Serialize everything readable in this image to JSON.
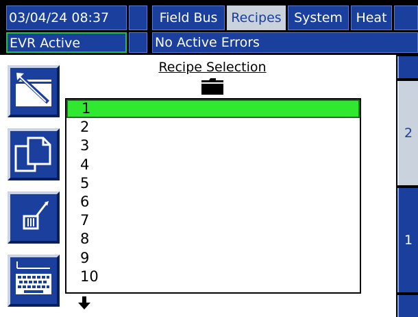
{
  "header": {
    "datetime": "03/04/24 08:37",
    "status": "EVR Active",
    "errors": "No Active Errors",
    "tabs": [
      {
        "label": "Field Bus",
        "active": false
      },
      {
        "label": "Recipes",
        "active": true
      },
      {
        "label": "System",
        "active": false
      },
      {
        "label": "Heat",
        "active": false
      }
    ]
  },
  "main": {
    "title": "Recipe Selection",
    "recipes": [
      "1",
      "2",
      "3",
      "4",
      "5",
      "6",
      "7",
      "8",
      "9",
      "10"
    ],
    "selected": "1"
  },
  "sidebar": {
    "buttons": [
      {
        "name": "back-icon"
      },
      {
        "name": "copy-icon"
      },
      {
        "name": "edit-icon"
      },
      {
        "name": "keyboard-icon"
      }
    ]
  },
  "pages": {
    "upper": "2",
    "lower": "1"
  },
  "colors": {
    "primary": "#1a3f9c",
    "selected": "#2fe82f",
    "inactive_tab": "#c9d2dd",
    "status_border": "#22c04a"
  }
}
